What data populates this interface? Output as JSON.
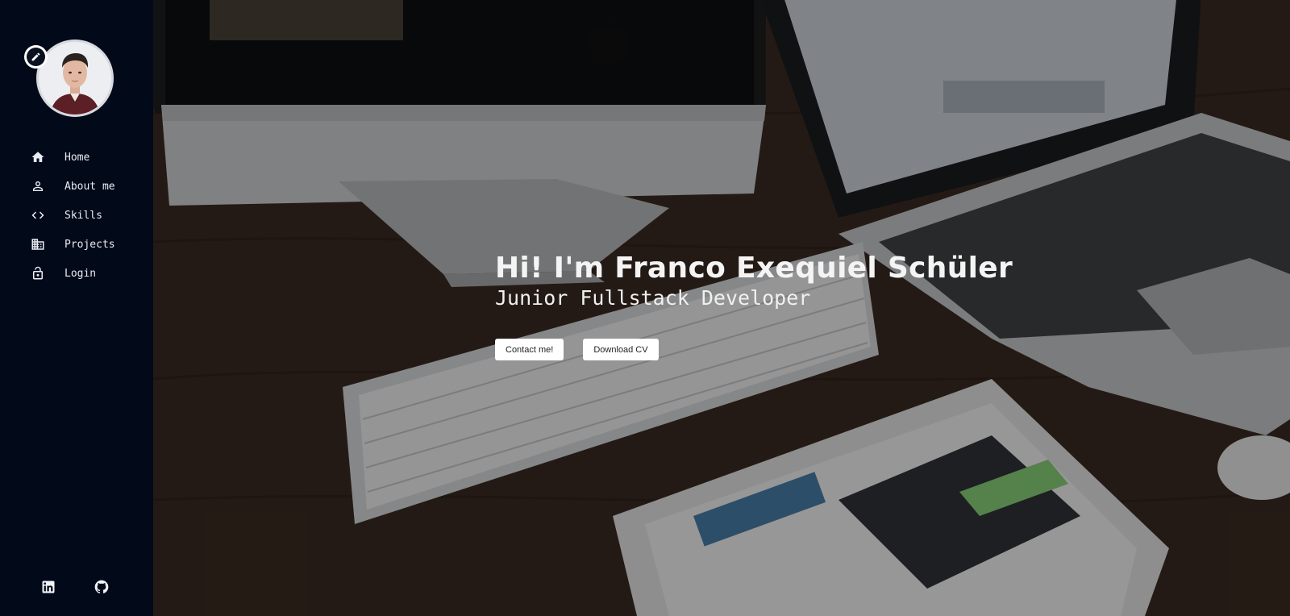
{
  "sidebar": {
    "avatar_alt": "Profile photo",
    "nav": [
      {
        "label": "Home",
        "icon": "home-icon"
      },
      {
        "label": "About me",
        "icon": "person-icon"
      },
      {
        "label": "Skills",
        "icon": "code-icon"
      },
      {
        "label": "Projects",
        "icon": "building-icon"
      },
      {
        "label": "Login",
        "icon": "lock-icon"
      }
    ],
    "socials": [
      {
        "icon": "linkedin-icon"
      },
      {
        "icon": "github-icon"
      }
    ]
  },
  "hero": {
    "title": "Hi! I'm Franco Exequiel Schüler",
    "subtitle": "Junior Fullstack Developer",
    "buttons": {
      "contact_label": "Contact me!",
      "download_label": "Download CV"
    }
  },
  "colors": {
    "sidebar_bg": "#020a1a",
    "nav_text": "#e9ecf3",
    "button_bg": "#ffffff"
  }
}
